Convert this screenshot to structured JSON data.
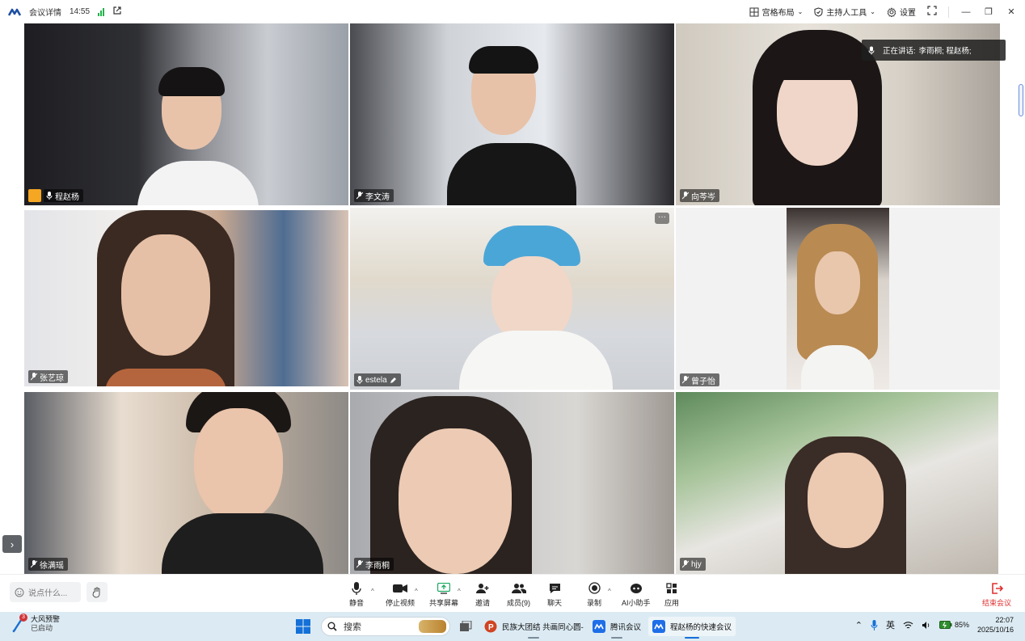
{
  "titlebar": {
    "meeting_details": "会议详情",
    "time": "14:55",
    "layout_label": "宫格布局",
    "host_tools_label": "主持人工具",
    "settings_label": "设置",
    "minimize": "—",
    "restore": "❐",
    "close": "✕"
  },
  "speaking": {
    "label": "正在讲话:",
    "names": "李雨桐; 程赵杨;"
  },
  "tiles": [
    {
      "name": "程赵杨",
      "host": true
    },
    {
      "name": "李文涛"
    },
    {
      "name": "向芩岑"
    },
    {
      "name": "张艺琼"
    },
    {
      "name": "estela"
    },
    {
      "name": "曾子怡"
    },
    {
      "name": "徐满瑶"
    },
    {
      "name": "李雨桐",
      "active": true
    },
    {
      "name": "hjy"
    }
  ],
  "more_label": "···",
  "expand_label": "›",
  "controls": {
    "chat_placeholder": "说点什么...",
    "mute": "静音",
    "stop_video": "停止视频",
    "share_screen": "共享屏幕",
    "invite": "邀请",
    "members": "成员(9)",
    "chat": "聊天",
    "record": "录制",
    "ai_assistant": "AI小助手",
    "apps": "应用",
    "end_meeting": "结束会议",
    "caret": "^"
  },
  "taskbar": {
    "weather_line1": "大风预警",
    "weather_line2": "已启动",
    "weather_badge": "3",
    "search_label": "搜索",
    "app_ppt": "民族大团结 共画同心圆-",
    "app_tencent": "腾讯会议",
    "app_meeting": "程赵杨的快速会议",
    "ime": "英",
    "battery": "85%",
    "clock_time": "22:07",
    "clock_date": "2025/10/16"
  },
  "colors": {
    "accent_green": "#21c27a",
    "signal_green": "#22b14c",
    "end_red": "#e03131",
    "host_orange": "#f5a623"
  }
}
